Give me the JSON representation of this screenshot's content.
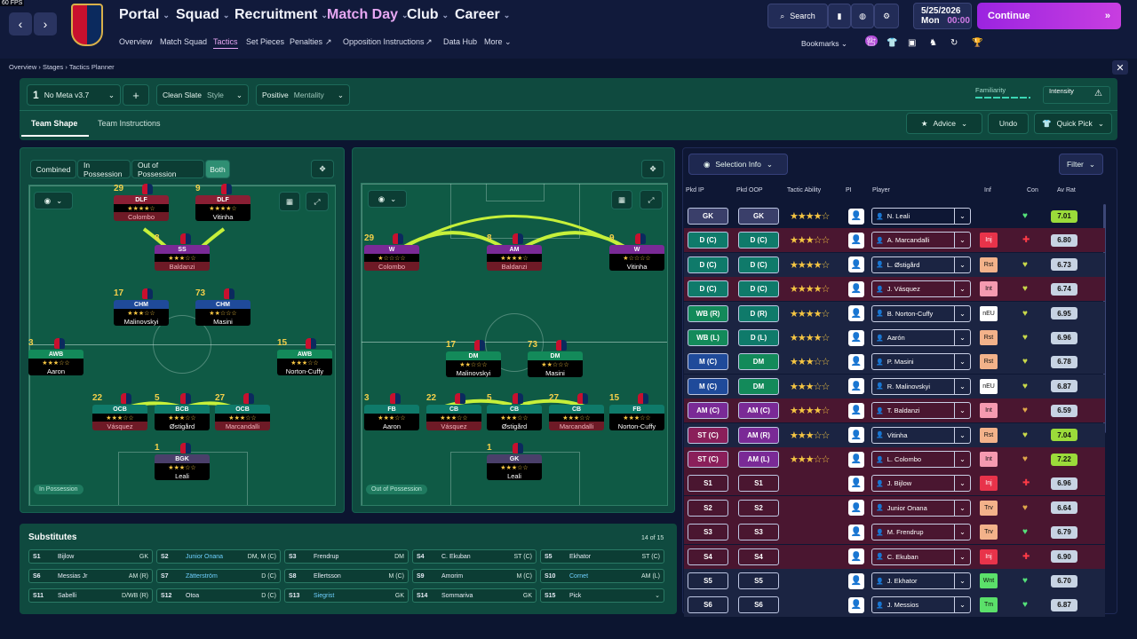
{
  "fps": "60 FPS",
  "nav": {
    "menus": [
      "Portal",
      "Squad",
      "Recruitment",
      "Match Day",
      "Club",
      "Career"
    ],
    "submenu": [
      "Overview",
      "Match Squad",
      "Tactics",
      "Set Pieces",
      "Penalties",
      "Opposition Instructions",
      "Data Hub",
      "More"
    ],
    "search": "Search",
    "date": "5/25/2026",
    "day": "Mon",
    "time": "00:00",
    "continue": "Continue",
    "bookmarks": "Bookmarks",
    "badge": "99+"
  },
  "breadcrumb": [
    "Overview",
    "Stages",
    "Tactics Planner"
  ],
  "tactics_bar": {
    "slot": "1",
    "tactic_name": "No Meta v3.7",
    "plus": "+",
    "style_value": "Clean Slate",
    "style_label": "Style",
    "mentality_value": "Positive",
    "mentality_label": "Mentality",
    "familiarity": "Familiarity",
    "intensity": "Intensity",
    "tabs": [
      "Team Shape",
      "Team Instructions"
    ],
    "advice": "Advice",
    "undo": "Undo",
    "quick_pick": "Quick Pick"
  },
  "phase_tabs": [
    "Combined",
    "In Possession",
    "Out of Possession",
    "Both"
  ],
  "in_possession_label": "In Possession",
  "out_possession_label": "Out of Possession",
  "ip_players": [
    {
      "num": "29",
      "role": "DLF",
      "stars": "★★★★☆",
      "name": "Colombo",
      "red": true,
      "roleColor": "#8a1f34"
    },
    {
      "num": "9",
      "role": "DLF",
      "stars": "★★★★☆",
      "name": "Vitinha",
      "red": false,
      "roleColor": "#8a1f34"
    },
    {
      "num": "8",
      "role": "SS",
      "stars": "★★★☆☆",
      "name": "Baldanzi",
      "red": true,
      "roleColor": "#7a2a96"
    },
    {
      "num": "17",
      "role": "CHM",
      "stars": "★★★☆☆",
      "name": "Malinovskyi",
      "red": false,
      "roleColor": "#1f4a9a"
    },
    {
      "num": "73",
      "role": "CHM",
      "stars": "★★☆☆☆",
      "name": "Masini",
      "red": false,
      "roleColor": "#1f4a9a"
    },
    {
      "num": "3",
      "role": "AWB",
      "stars": "★★★☆☆",
      "name": "Aaron",
      "red": false,
      "roleColor": "#138a5a"
    },
    {
      "num": "15",
      "role": "AWB",
      "stars": "★★★☆☆",
      "name": "Norton-Cuffy",
      "red": false,
      "roleColor": "#138a5a"
    },
    {
      "num": "22",
      "role": "OCB",
      "stars": "★★★☆☆",
      "name": "Vásquez",
      "red": true,
      "roleColor": "#0f7a6a"
    },
    {
      "num": "5",
      "role": "BCB",
      "stars": "★★★☆☆",
      "name": "Østigård",
      "red": false,
      "roleColor": "#0f7a6a"
    },
    {
      "num": "27",
      "role": "OCB",
      "stars": "★★★☆☆",
      "name": "Marcandalli",
      "red": true,
      "roleColor": "#0f7a6a"
    },
    {
      "num": "1",
      "role": "BGK",
      "stars": "★★★☆☆",
      "name": "Leali",
      "red": false,
      "roleColor": "#4a3f6a"
    }
  ],
  "oop_players": [
    {
      "num": "29",
      "role": "W",
      "stars": "★☆☆☆☆",
      "name": "Colombo",
      "red": true,
      "roleColor": "#7a2a96"
    },
    {
      "num": "8",
      "role": "AM",
      "stars": "★★★★☆",
      "name": "Baldanzi",
      "red": true,
      "roleColor": "#7a2a96"
    },
    {
      "num": "9",
      "role": "W",
      "stars": "★☆☆☆☆",
      "name": "Vitinha",
      "red": false,
      "roleColor": "#7a2a96"
    },
    {
      "num": "17",
      "role": "DM",
      "stars": "★★☆☆☆",
      "name": "Malinovskyi",
      "red": false,
      "roleColor": "#138a5a"
    },
    {
      "num": "73",
      "role": "DM",
      "stars": "★★☆☆☆",
      "name": "Masini",
      "red": false,
      "roleColor": "#138a5a"
    },
    {
      "num": "3",
      "role": "FB",
      "stars": "★★★☆☆",
      "name": "Aaron",
      "red": false,
      "roleColor": "#0f7a6a"
    },
    {
      "num": "22",
      "role": "CB",
      "stars": "★★★☆☆",
      "name": "Vásquez",
      "red": true,
      "roleColor": "#0f7a6a"
    },
    {
      "num": "5",
      "role": "CB",
      "stars": "★★★☆☆",
      "name": "Østigård",
      "red": false,
      "roleColor": "#0f7a6a"
    },
    {
      "num": "27",
      "role": "CB",
      "stars": "★★★☆☆",
      "name": "Marcandalli",
      "red": true,
      "roleColor": "#0f7a6a"
    },
    {
      "num": "15",
      "role": "FB",
      "stars": "★★★☆☆",
      "name": "Norton-Cuffy",
      "red": false,
      "roleColor": "#0f7a6a"
    },
    {
      "num": "1",
      "role": "GK",
      "stars": "★★★☆☆",
      "name": "Leali",
      "red": false,
      "roleColor": "#4a3f6a"
    }
  ],
  "selection": {
    "button": "Selection Info",
    "filter": "Filter",
    "headers": [
      "Pkd IP",
      "Pkd OOP",
      "Tactic Ability",
      "PI",
      "Player",
      "Inf",
      "Con",
      "Av Rat"
    ],
    "rows": [
      {
        "ip": "GK",
        "oop": "GK",
        "stars": "★★★★☆",
        "player": "N. Leali",
        "inf": "",
        "con": "♥",
        "rat": "7.01",
        "row": "",
        "ipColor": "#3a3f6a",
        "oopColor": "#3a3f6a",
        "infColor": "",
        "ratColor": "#9bdb3a",
        "conColor": "#55e27a"
      },
      {
        "ip": "D (C)",
        "oop": "D (C)",
        "stars": "★★★☆☆",
        "player": "A. Marcandalli",
        "inf": "Inj",
        "con": "✚",
        "rat": "6.80",
        "row": "red",
        "ipColor": "#0f7a6a",
        "oopColor": "#0f7a6a",
        "infColor": "#e8334a",
        "ratColor": "#c7d3e3",
        "conColor": "#ff3b47"
      },
      {
        "ip": "D (C)",
        "oop": "D (C)",
        "stars": "★★★★☆",
        "player": "L. Østigård",
        "inf": "Rst",
        "con": "♥",
        "rat": "6.73",
        "row": "grey",
        "ipColor": "#0f7a6a",
        "oopColor": "#0f7a6a",
        "infColor": "#f3b28a",
        "ratColor": "#c7d3e3",
        "conColor": "#c9d94a"
      },
      {
        "ip": "D (C)",
        "oop": "D (C)",
        "stars": "★★★★☆",
        "player": "J. Vásquez",
        "inf": "Int",
        "con": "♥",
        "rat": "6.74",
        "row": "red",
        "ipColor": "#0f7a6a",
        "oopColor": "#0f7a6a",
        "infColor": "#f59ab0",
        "ratColor": "#c7d3e3",
        "conColor": "#c9d94a"
      },
      {
        "ip": "WB (R)",
        "oop": "D (R)",
        "stars": "★★★★☆",
        "player": "B. Norton-Cuffy",
        "inf": "nEU",
        "con": "♥",
        "rat": "6.95",
        "row": "grey",
        "ipColor": "#138a5a",
        "oopColor": "#0f7a6a",
        "infColor": "#ffffff",
        "ratColor": "#c7d3e3",
        "conColor": "#c9d94a"
      },
      {
        "ip": "WB (L)",
        "oop": "D (L)",
        "stars": "★★★★☆",
        "player": "Aarón",
        "inf": "Rst",
        "con": "♥",
        "rat": "6.96",
        "row": "grey",
        "ipColor": "#138a5a",
        "oopColor": "#0f7a6a",
        "infColor": "#f3b28a",
        "ratColor": "#c7d3e3",
        "conColor": "#c9d94a"
      },
      {
        "ip": "M (C)",
        "oop": "DM",
        "stars": "★★★☆☆",
        "player": "P. Masini",
        "inf": "Rst",
        "con": "♥",
        "rat": "6.78",
        "row": "grey",
        "ipColor": "#1f4a9a",
        "oopColor": "#138a5a",
        "infColor": "#f3b28a",
        "ratColor": "#c7d3e3",
        "conColor": "#c9d94a"
      },
      {
        "ip": "M (C)",
        "oop": "DM",
        "stars": "★★★☆☆",
        "player": "R. Malinovskyi",
        "inf": "nEU",
        "con": "♥",
        "rat": "6.87",
        "row": "grey",
        "ipColor": "#1f4a9a",
        "oopColor": "#138a5a",
        "infColor": "#ffffff",
        "ratColor": "#c7d3e3",
        "conColor": "#c9d94a"
      },
      {
        "ip": "AM (C)",
        "oop": "AM (C)",
        "stars": "★★★★☆",
        "player": "T. Baldanzi",
        "inf": "Int",
        "con": "♥",
        "rat": "6.59",
        "row": "red",
        "ipColor": "#7a2a96",
        "oopColor": "#7a2a96",
        "infColor": "#f59ab0",
        "ratColor": "#c7d3e3",
        "conColor": "#e0a84a"
      },
      {
        "ip": "ST (C)",
        "oop": "AM (R)",
        "stars": "★★★☆☆",
        "player": "Vitinha",
        "inf": "Rst",
        "con": "♥",
        "rat": "7.04",
        "row": "grey",
        "ipColor": "#8a1f5a",
        "oopColor": "#7a2a96",
        "infColor": "#f3b28a",
        "ratColor": "#9bdb3a",
        "conColor": "#c9d94a"
      },
      {
        "ip": "ST (C)",
        "oop": "AM (L)",
        "stars": "★★★☆☆",
        "player": "L. Colombo",
        "inf": "Int",
        "con": "♥",
        "rat": "7.22",
        "row": "red",
        "ipColor": "#8a1f5a",
        "oopColor": "#7a2a96",
        "infColor": "#f59ab0",
        "ratColor": "#9bdb3a",
        "conColor": "#e0a84a"
      },
      {
        "ip": "S1",
        "oop": "S1",
        "stars": "",
        "player": "J. Bijlow",
        "inf": "Inj",
        "con": "✚",
        "rat": "6.96",
        "row": "red",
        "ipColor": "#4a1630",
        "oopColor": "#4a1630",
        "infColor": "#e8334a",
        "ratColor": "#c7d3e3",
        "conColor": "#ff3b47"
      },
      {
        "ip": "S2",
        "oop": "S2",
        "stars": "",
        "player": "Junior Onana",
        "inf": "Trv",
        "con": "♥",
        "rat": "6.64",
        "row": "red",
        "ipColor": "#4a1630",
        "oopColor": "#4a1630",
        "infColor": "#f3b28a",
        "ratColor": "#c7d3e3",
        "conColor": "#e0a84a"
      },
      {
        "ip": "S3",
        "oop": "S3",
        "stars": "",
        "player": "M. Frendrup",
        "inf": "Trv",
        "con": "♥",
        "rat": "6.79",
        "row": "red",
        "ipColor": "#4a1630",
        "oopColor": "#4a1630",
        "infColor": "#f3b28a",
        "ratColor": "#c7d3e3",
        "conColor": "#55e27a"
      },
      {
        "ip": "S4",
        "oop": "S4",
        "stars": "",
        "player": "C. Ekuban",
        "inf": "Inj",
        "con": "✚",
        "rat": "6.90",
        "row": "red",
        "ipColor": "#4a1630",
        "oopColor": "#4a1630",
        "infColor": "#e8334a",
        "ratColor": "#c7d3e3",
        "conColor": "#ff3b47"
      },
      {
        "ip": "S5",
        "oop": "S5",
        "stars": "",
        "player": "J. Ekhator",
        "inf": "Wnt",
        "con": "♥",
        "rat": "6.70",
        "row": "grey",
        "ipColor": "#1b2442",
        "oopColor": "#1b2442",
        "infColor": "#5be06a",
        "ratColor": "#c7d3e3",
        "conColor": "#55e27a"
      },
      {
        "ip": "S6",
        "oop": "S6",
        "stars": "",
        "player": "J. Messios",
        "inf": "Tm",
        "con": "♥",
        "rat": "6.87",
        "row": "grey",
        "ipColor": "#1b2442",
        "oopColor": "#1b2442",
        "infColor": "#5be06a",
        "ratColor": "#c7d3e3",
        "conColor": "#55e27a"
      }
    ]
  },
  "substitutes": {
    "title": "Substitutes",
    "count": "14 of 15",
    "items": [
      {
        "slot": "S1",
        "name": "Bijlow",
        "pos": "GK",
        "hl": false
      },
      {
        "slot": "S2",
        "name": "Junior Onana",
        "pos": "DM, M (C)",
        "hl": true
      },
      {
        "slot": "S3",
        "name": "Frendrup",
        "pos": "DM",
        "hl": false
      },
      {
        "slot": "S4",
        "name": "C. Ekuban",
        "pos": "ST (C)",
        "hl": false
      },
      {
        "slot": "S5",
        "name": "Ekhator",
        "pos": "ST (C)",
        "hl": false
      },
      {
        "slot": "S6",
        "name": "Messias Jr",
        "pos": "AM (R)",
        "hl": false
      },
      {
        "slot": "S7",
        "name": "Zätterström",
        "pos": "D (C)",
        "hl": true
      },
      {
        "slot": "S8",
        "name": "Ellertsson",
        "pos": "M (C)",
        "hl": false
      },
      {
        "slot": "S9",
        "name": "Amorim",
        "pos": "M (C)",
        "hl": false
      },
      {
        "slot": "S10",
        "name": "Cornet",
        "pos": "AM (L)",
        "hl": true
      },
      {
        "slot": "S11",
        "name": "Sabelli",
        "pos": "D/WB (R)",
        "hl": false
      },
      {
        "slot": "S12",
        "name": "Otoa",
        "pos": "D (C)",
        "hl": false
      },
      {
        "slot": "S13",
        "name": "Siegrist",
        "pos": "GK",
        "hl": true
      },
      {
        "slot": "S14",
        "name": "Sommariva",
        "pos": "GK",
        "hl": false
      },
      {
        "slot": "S15",
        "name": "Pick",
        "pos": "",
        "hl": false
      }
    ]
  }
}
